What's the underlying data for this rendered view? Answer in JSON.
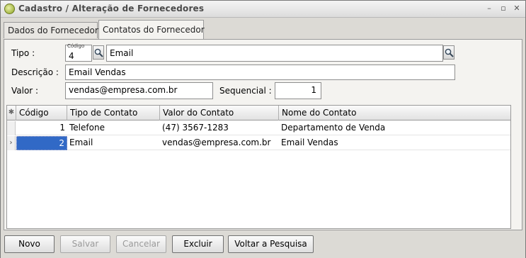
{
  "window": {
    "title": "Cadastro / Alteração de Fornecedores",
    "controls": {
      "minimize": "–",
      "maximize": "▫",
      "close": "✕"
    }
  },
  "tabs": [
    {
      "label": "Dados do Fornecedor",
      "active": false
    },
    {
      "label": "Contatos do Fornecedor",
      "active": true
    }
  ],
  "form": {
    "tipo_label": "Tipo :",
    "codigo_caption": "Código",
    "tipo_codigo": "4",
    "tipo_nome": "Email",
    "descricao_label": "Descrição :",
    "descricao_value": "Email Vendas",
    "valor_label": "Valor :",
    "valor_value": "vendas@empresa.com.br",
    "sequencial_label": "Sequencial :",
    "sequencial_value": "1"
  },
  "grid": {
    "corner_symbol": "✱",
    "columns": [
      "Código",
      "Tipo de Contato",
      "Valor do Contato",
      "Nome do Contato"
    ],
    "rows": [
      {
        "indicator": "",
        "codigo": "1",
        "tipo": "Telefone",
        "valor": "(47) 3567-1283",
        "nome": "Departamento de Venda"
      },
      {
        "indicator": "›",
        "codigo": "2",
        "tipo": "Email",
        "valor": "vendas@empresa.com.br",
        "nome": "Email Vendas"
      }
    ]
  },
  "buttons": {
    "novo": "Novo",
    "salvar": "Salvar",
    "cancelar": "Cancelar",
    "excluir": "Excluir",
    "voltar": "Voltar a Pesquisa"
  },
  "colors": {
    "selection": "#3169c6",
    "panel": "#f4f3f0",
    "window": "#dcdad5"
  }
}
